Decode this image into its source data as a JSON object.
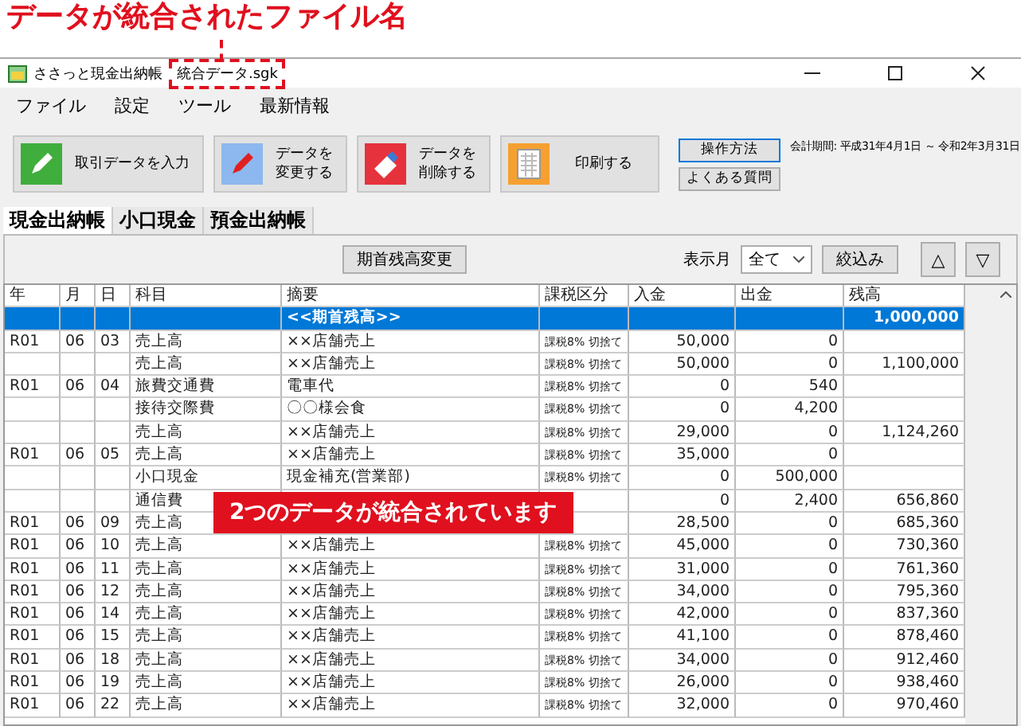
{
  "annotation": {
    "title": "データが統合されたファイル名",
    "banner": "2つのデータが統合されています"
  },
  "window": {
    "app_name": "ささっと現金出納帳",
    "file_name": "統合データ.sgk"
  },
  "menu": [
    "ファイル",
    "設定",
    "ツール",
    "最新情報"
  ],
  "toolbar": [
    {
      "kind": "pencil",
      "lines": [
        "取引データを入力"
      ]
    },
    {
      "kind": "edit",
      "lines": [
        "データを",
        "変更する"
      ]
    },
    {
      "kind": "eraser",
      "lines": [
        "データを",
        "削除する"
      ]
    },
    {
      "kind": "print",
      "lines": [
        "印刷する"
      ]
    }
  ],
  "help_buttons": [
    "操作方法",
    "よくある質問"
  ],
  "fiscal_period": "会計期間: 平成31年4月1日 ～ 令和2年3月31日",
  "tabs": [
    {
      "label": "現金出納帳",
      "selected": true
    },
    {
      "label": "小口現金",
      "selected": false
    },
    {
      "label": "預金出納帳",
      "selected": false
    }
  ],
  "filter": {
    "opening_button": "期首残高変更",
    "month_label": "表示月",
    "month_value": "全て",
    "filter_button": "絞込み",
    "up": "△",
    "down": "▽"
  },
  "table": {
    "columns": [
      "年",
      "月",
      "日",
      "科目",
      "摘要",
      "課税区分",
      "入金",
      "出金",
      "残高"
    ],
    "rows": [
      {
        "selected": true,
        "cells": [
          "",
          "",
          "",
          "",
          "<<期首残高>>",
          "",
          "",
          "",
          "1,000,000"
        ]
      },
      {
        "selected": false,
        "cells": [
          "R01",
          "06",
          "03",
          "売上高",
          "××店舗売上",
          "課税8% 切捨て",
          "50,000",
          "0",
          ""
        ]
      },
      {
        "selected": false,
        "cells": [
          "",
          "",
          "",
          "売上高",
          "××店舗売上",
          "課税8% 切捨て",
          "50,000",
          "0",
          "1,100,000"
        ]
      },
      {
        "selected": false,
        "cells": [
          "R01",
          "06",
          "04",
          "旅費交通費",
          "電車代",
          "課税8% 切捨て",
          "0",
          "540",
          ""
        ]
      },
      {
        "selected": false,
        "cells": [
          "",
          "",
          "",
          "接待交際費",
          "〇〇様会食",
          "課税8% 切捨て",
          "0",
          "4,200",
          ""
        ]
      },
      {
        "selected": false,
        "cells": [
          "",
          "",
          "",
          "売上高",
          "××店舗売上",
          "課税8% 切捨て",
          "29,000",
          "0",
          "1,124,260"
        ]
      },
      {
        "selected": false,
        "cells": [
          "R01",
          "06",
          "05",
          "売上高",
          "××店舗売上",
          "課税8% 切捨て",
          "35,000",
          "0",
          ""
        ]
      },
      {
        "selected": false,
        "cells": [
          "",
          "",
          "",
          "小口現金",
          "現金補充(営業部)",
          "課税8% 切捨て",
          "0",
          "500,000",
          ""
        ]
      },
      {
        "selected": false,
        "cells": [
          "",
          "",
          "",
          "通信費",
          "",
          "",
          "0",
          "2,400",
          "656,860"
        ]
      },
      {
        "selected": false,
        "cells": [
          "R01",
          "06",
          "09",
          "売上高",
          "",
          "",
          "28,500",
          "0",
          "685,360"
        ]
      },
      {
        "selected": false,
        "cells": [
          "R01",
          "06",
          "10",
          "売上高",
          "××店舗売上",
          "課税8% 切捨て",
          "45,000",
          "0",
          "730,360"
        ]
      },
      {
        "selected": false,
        "cells": [
          "R01",
          "06",
          "11",
          "売上高",
          "××店舗売上",
          "課税8% 切捨て",
          "31,000",
          "0",
          "761,360"
        ]
      },
      {
        "selected": false,
        "cells": [
          "R01",
          "06",
          "12",
          "売上高",
          "××店舗売上",
          "課税8% 切捨て",
          "34,000",
          "0",
          "795,360"
        ]
      },
      {
        "selected": false,
        "cells": [
          "R01",
          "06",
          "14",
          "売上高",
          "××店舗売上",
          "課税8% 切捨て",
          "42,000",
          "0",
          "837,360"
        ]
      },
      {
        "selected": false,
        "cells": [
          "R01",
          "06",
          "15",
          "売上高",
          "××店舗売上",
          "課税8% 切捨て",
          "41,100",
          "0",
          "878,460"
        ]
      },
      {
        "selected": false,
        "cells": [
          "R01",
          "06",
          "18",
          "売上高",
          "××店舗売上",
          "課税8% 切捨て",
          "34,000",
          "0",
          "912,460"
        ]
      },
      {
        "selected": false,
        "cells": [
          "R01",
          "06",
          "19",
          "売上高",
          "××店舗売上",
          "課税8% 切捨て",
          "26,000",
          "0",
          "938,460"
        ]
      },
      {
        "selected": false,
        "cells": [
          "R01",
          "06",
          "22",
          "売上高",
          "××店舗売上",
          "課税8% 切捨て",
          "32,000",
          "0",
          "970,460"
        ]
      }
    ]
  }
}
